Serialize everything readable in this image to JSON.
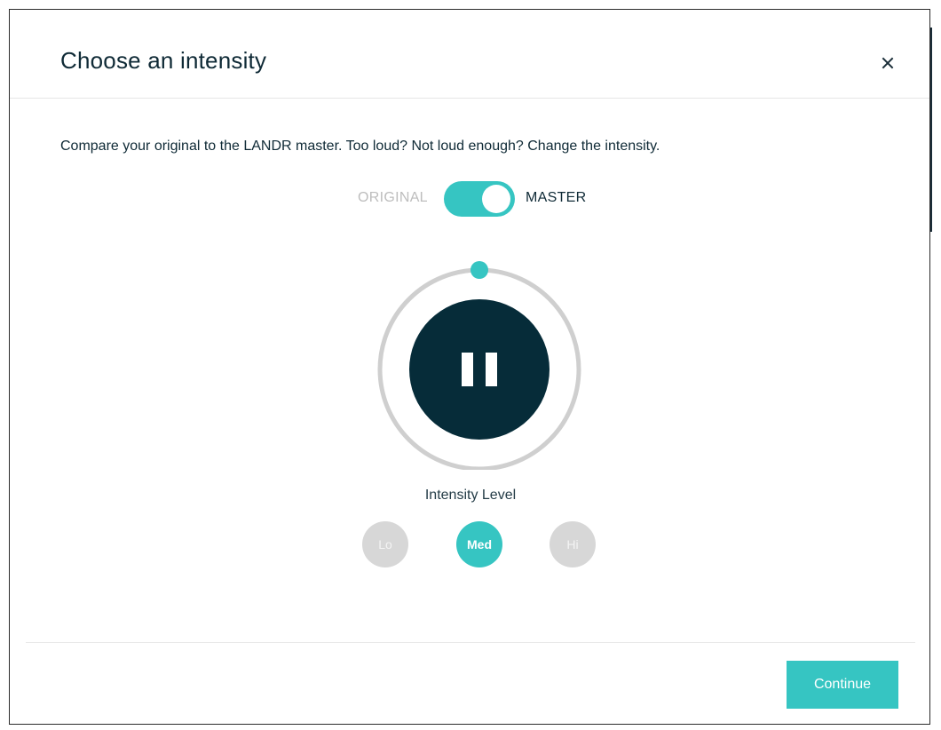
{
  "dialog": {
    "title": "Choose an intensity",
    "close_glyph": "close-icon",
    "description": "Compare your original to the LANDR master. Too loud? Not loud enough? Change the intensity."
  },
  "toggle": {
    "left_label": "ORIGINAL",
    "right_label": "MASTER",
    "selected": "MASTER"
  },
  "player": {
    "state": "playing",
    "icon": "pause-icon",
    "playback_progress": 0
  },
  "intensity": {
    "label": "Intensity Level",
    "options": [
      {
        "label": "Lo",
        "active": false
      },
      {
        "label": "Med",
        "active": true
      },
      {
        "label": "Hi",
        "active": false
      }
    ]
  },
  "footer": {
    "continue_label": "Continue"
  },
  "colors": {
    "accent": "#36c5c2",
    "dark": "#062c39",
    "inactive": "#d7d7d7"
  }
}
